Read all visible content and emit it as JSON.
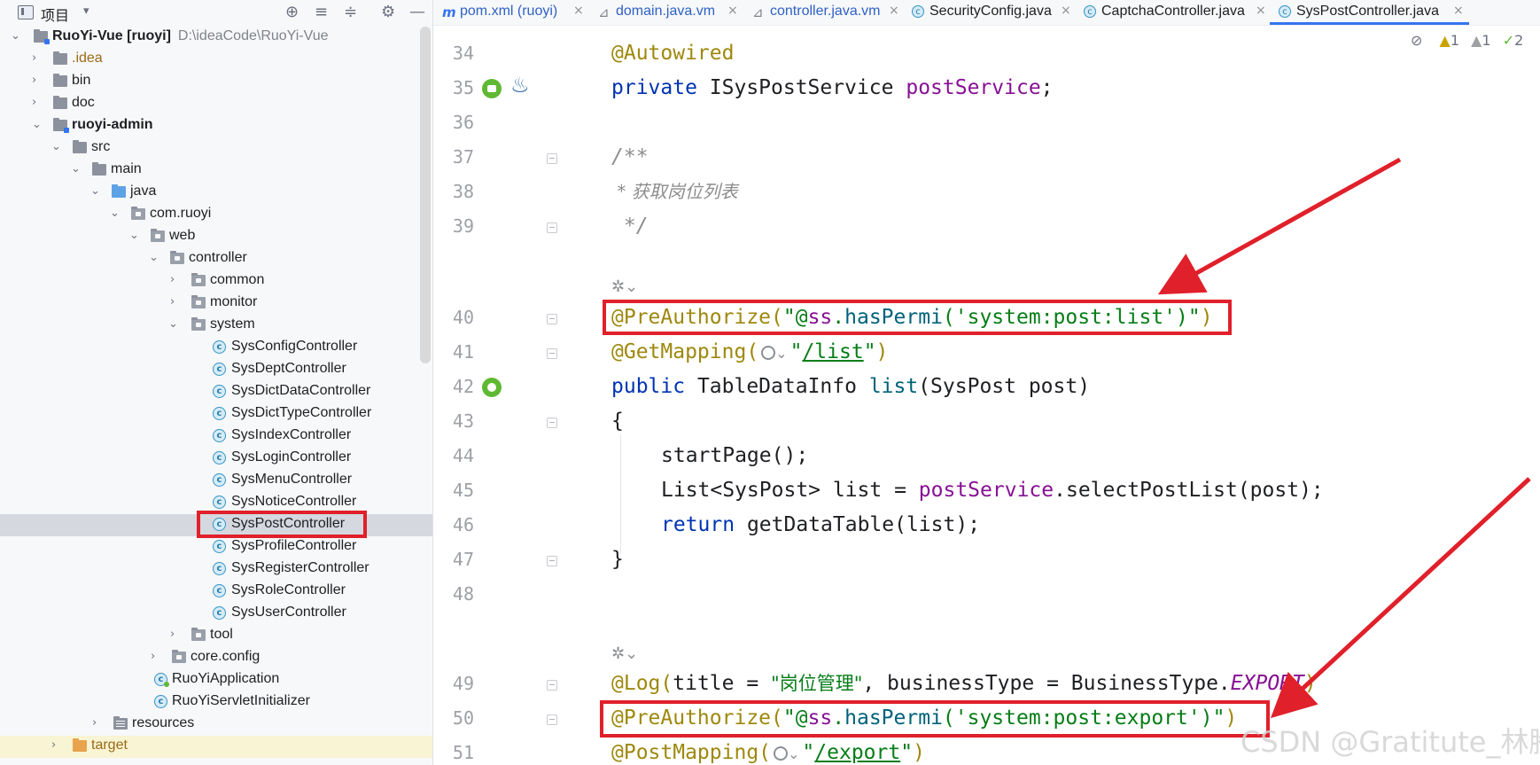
{
  "project_panel": {
    "title": "项目",
    "toolbar_icons": [
      "target-icon",
      "expand-all-icon",
      "collapse-all-icon",
      "gear-icon",
      "minimize-icon"
    ],
    "tree": [
      {
        "label": "RuoYi-Vue [ruoyi]",
        "path": "D:\\ideaCode\\RuoYi-Vue",
        "icon": "module-folder",
        "expanded": true,
        "depth": 0
      },
      {
        "label": ".idea",
        "icon": "folder",
        "expanded": false,
        "depth": 1
      },
      {
        "label": "bin",
        "icon": "folder",
        "expanded": false,
        "depth": 1
      },
      {
        "label": "doc",
        "icon": "folder",
        "expanded": false,
        "depth": 1
      },
      {
        "label": "ruoyi-admin",
        "icon": "module-folder",
        "expanded": true,
        "depth": 1
      },
      {
        "label": "src",
        "icon": "folder",
        "expanded": true,
        "depth": 2
      },
      {
        "label": "main",
        "icon": "folder",
        "expanded": true,
        "depth": 3
      },
      {
        "label": "java",
        "icon": "source-folder",
        "expanded": true,
        "depth": 4
      },
      {
        "label": "com.ruoyi",
        "icon": "package",
        "expanded": true,
        "depth": 5
      },
      {
        "label": "web",
        "icon": "package",
        "expanded": true,
        "depth": 6
      },
      {
        "label": "controller",
        "icon": "package",
        "expanded": true,
        "depth": 7
      },
      {
        "label": "common",
        "icon": "package",
        "expanded": false,
        "depth": 8
      },
      {
        "label": "monitor",
        "icon": "package",
        "expanded": false,
        "depth": 8
      },
      {
        "label": "system",
        "icon": "package",
        "expanded": true,
        "depth": 8
      },
      {
        "label": "SysConfigController",
        "icon": "class",
        "depth": 9
      },
      {
        "label": "SysDeptController",
        "icon": "class",
        "depth": 9
      },
      {
        "label": "SysDictDataController",
        "icon": "class",
        "depth": 9
      },
      {
        "label": "SysDictTypeController",
        "icon": "class",
        "depth": 9
      },
      {
        "label": "SysIndexController",
        "icon": "class",
        "depth": 9
      },
      {
        "label": "SysLoginController",
        "icon": "class",
        "depth": 9
      },
      {
        "label": "SysMenuController",
        "icon": "class",
        "depth": 9
      },
      {
        "label": "SysNoticeController",
        "icon": "class",
        "depth": 9
      },
      {
        "label": "SysPostController",
        "icon": "class",
        "depth": 9,
        "selected": true
      },
      {
        "label": "SysProfileController",
        "icon": "class",
        "depth": 9
      },
      {
        "label": "SysRegisterController",
        "icon": "class",
        "depth": 9
      },
      {
        "label": "SysRoleController",
        "icon": "class",
        "depth": 9
      },
      {
        "label": "SysUserController",
        "icon": "class",
        "depth": 9
      },
      {
        "label": "tool",
        "icon": "package",
        "expanded": false,
        "depth": 8
      },
      {
        "label": "core.config",
        "icon": "package",
        "expanded": false,
        "depth": 7
      },
      {
        "label": "RuoYiApplication",
        "icon": "app-class",
        "depth": 6
      },
      {
        "label": "RuoYiServletInitializer",
        "icon": "class",
        "depth": 6
      },
      {
        "label": "resources",
        "icon": "resources-folder",
        "expanded": false,
        "depth": 4
      },
      {
        "label": "target",
        "icon": "excluded-folder",
        "expanded": false,
        "depth": 2
      }
    ]
  },
  "tabs": [
    {
      "label": "pom.xml (ruoyi)",
      "icon": "maven-icon",
      "active": false
    },
    {
      "label": "domain.java.vm",
      "icon": "vm-icon",
      "active": false
    },
    {
      "label": "controller.java.vm",
      "icon": "vm-icon",
      "active": false
    },
    {
      "label": "SecurityConfig.java",
      "icon": "class-icon",
      "active": false
    },
    {
      "label": "CaptchaController.java",
      "icon": "class-icon",
      "active": false
    },
    {
      "label": "SysPostController.java",
      "icon": "class-icon",
      "active": true
    }
  ],
  "indicators": {
    "warnings": "1",
    "weak_warnings": "1",
    "ok_count": "2"
  },
  "editor": {
    "line_numbers": [
      "34",
      "35",
      "36",
      "37",
      "38",
      "39",
      "40",
      "41",
      "42",
      "43",
      "44",
      "45",
      "46",
      "47",
      "48",
      "49",
      "50",
      "51"
    ],
    "code": {
      "l34_at": "@Autowired",
      "l35_kw": "private",
      "l35_type": " ISysPostService ",
      "l35_field": "postService",
      "l35_end": ";",
      "l37": "/**",
      "l38": " * 获取岗位列表",
      "l39": " */",
      "l40_at": "@PreAuthorize(",
      "l40_q1": "\"@",
      "l40_ss": "ss",
      "l40_dot": ".",
      "l40_m": "hasPermi",
      "l40_args": "('system:post:list')",
      "l40_q2": "\"",
      "l40_close": ")",
      "l41_at": "@GetMapping(",
      "l41_q1": "\"",
      "l41_path": "/list",
      "l41_q2": "\"",
      "l41_close": ")",
      "l42_kw": "public",
      "l42_type": " TableDataInfo ",
      "l42_m": "list",
      "l42_params": "(SysPost post)",
      "l43": "{",
      "l44": "startPage();",
      "l45_a": "List<SysPost> list = ",
      "l45_f": "postService",
      "l45_b": ".selectPostList(post);",
      "l46_kw": "return",
      "l46_rest": " getDataTable(list);",
      "l47": "}",
      "l49_at": "@Log(",
      "l49_a": "title = ",
      "l49_s": "\"岗位管理\"",
      "l49_b": ", businessType = BusinessType.",
      "l49_e": "EXPORT",
      "l49_close": ")",
      "l50_at": "@PreAuthorize(",
      "l50_q1": "\"@",
      "l50_ss": "ss",
      "l50_dot": ".",
      "l50_m": "hasPermi",
      "l50_args": "('system:post:export')",
      "l50_q2": "\"",
      "l50_close": ")",
      "l51_at": "@PostMapping(",
      "l51_q1": "\"",
      "l51_path": "/export",
      "l51_q2": "\"",
      "l51_close": ")"
    }
  },
  "watermark": "CSDN @Gratitute_林腾",
  "colors": {
    "annotation": "#9e880d",
    "keyword": "#0033b3",
    "string": "#067d17",
    "field": "#871094",
    "method": "#00627a",
    "highlight_box": "#e0202a"
  }
}
